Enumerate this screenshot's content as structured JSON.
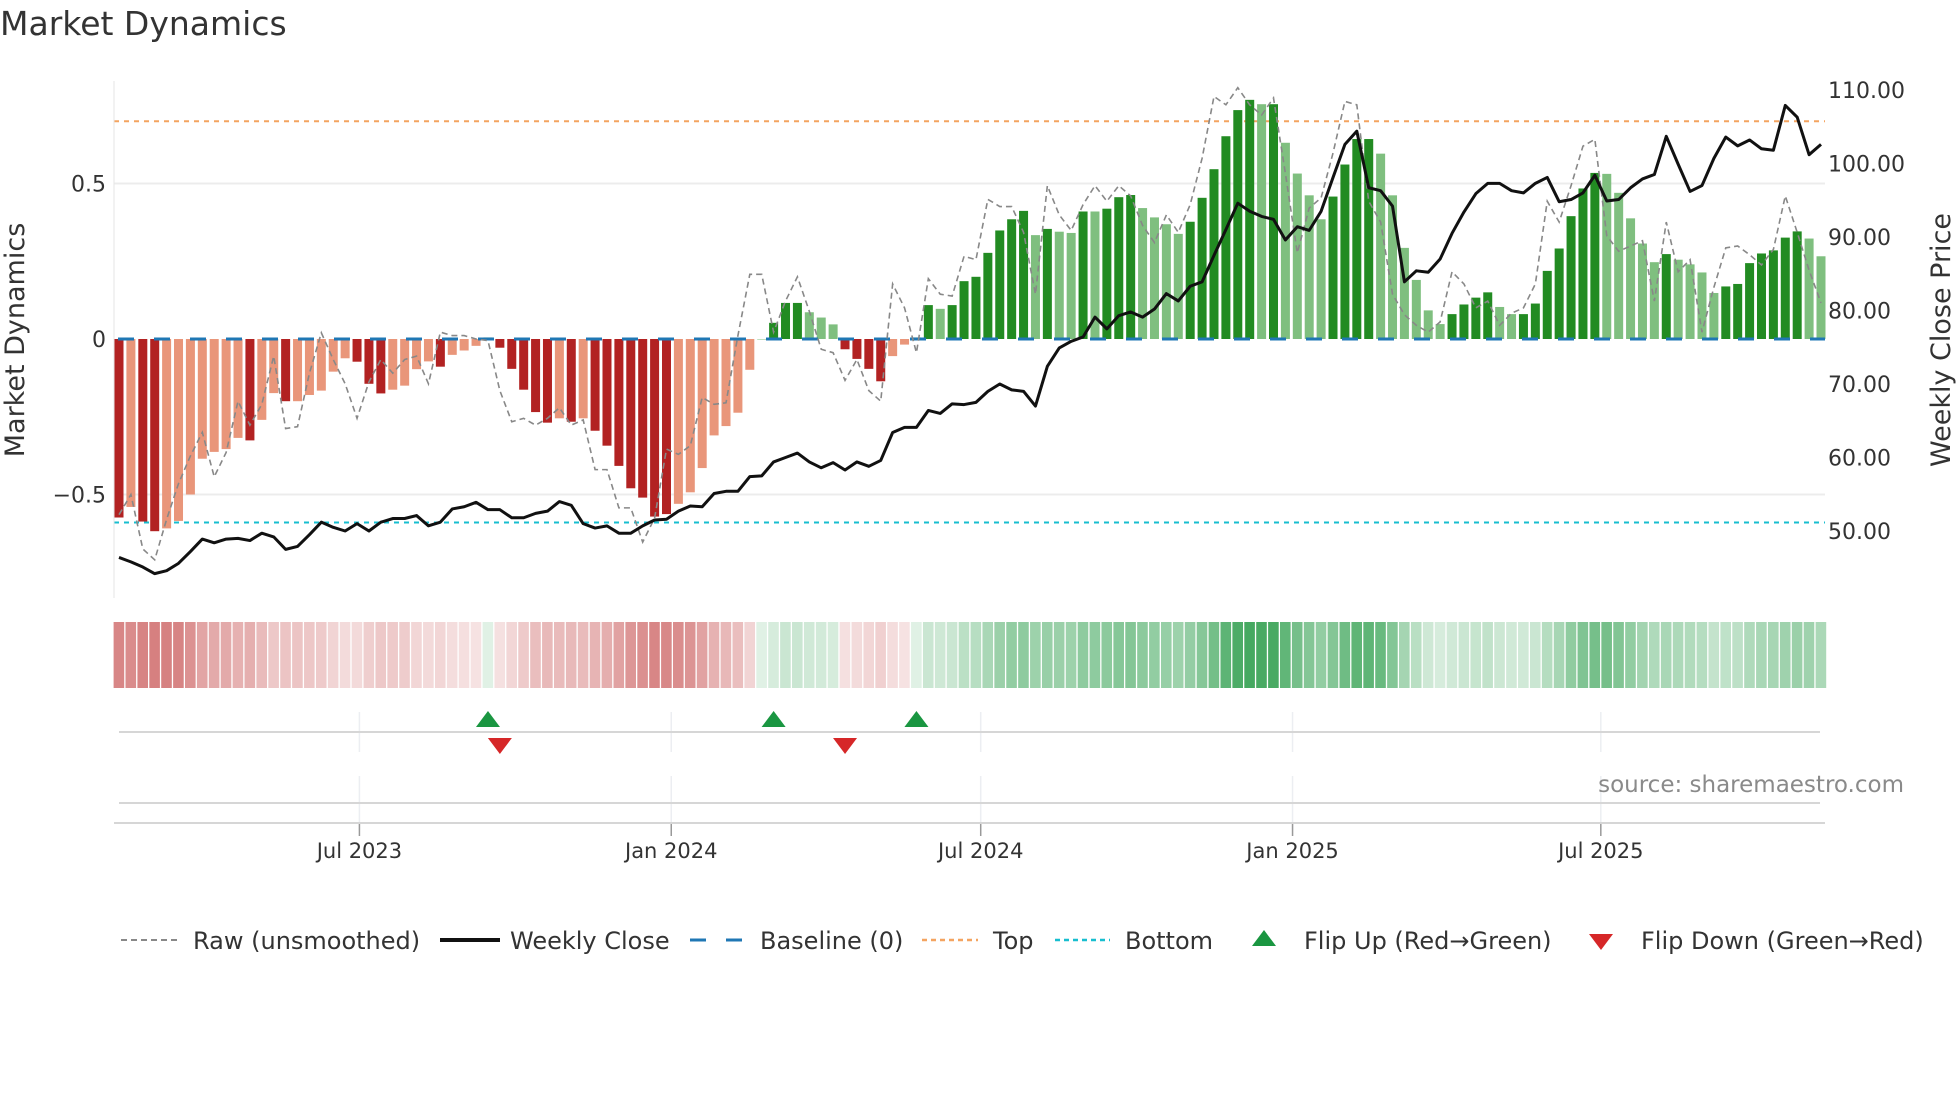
{
  "title": "Market Dynamics",
  "source": "source: sharemaestro.com",
  "colors": {
    "bar_red_dark": "#b22222",
    "bar_red_light": "#e9967a",
    "bar_green_dark": "#228b22",
    "bar_green_light": "#7fbf7f",
    "close": "#111111",
    "raw": "#888888",
    "baseline": "#1f77b4",
    "top": "#f4a460",
    "bottom": "#17becf",
    "flip_up": "#1a9641",
    "flip_down": "#d62728"
  },
  "chart_data": {
    "type": "bar",
    "title": "Market Dynamics",
    "ylabel": "Market Dynamics",
    "y2label": "Weekly Close Price",
    "ylim": [
      -0.78,
      0.85
    ],
    "y2lim": [
      40,
      113
    ],
    "yticks": [
      {
        "v": 0.5,
        "label": "0.5"
      },
      {
        "v": 0,
        "label": "0"
      },
      {
        "v": -0.5,
        "label": "−0.5"
      }
    ],
    "y2ticks": [
      {
        "v": 110,
        "label": "110.00"
      },
      {
        "v": 100,
        "label": "100.00"
      },
      {
        "v": 90,
        "label": "90.00"
      },
      {
        "v": 80,
        "label": "80.00"
      },
      {
        "v": 70,
        "label": "70.00"
      },
      {
        "v": 60,
        "label": "60.00"
      },
      {
        "v": 50,
        "label": "50.00"
      }
    ],
    "xticks": [
      {
        "week": 20.2,
        "label": "Jul 2023"
      },
      {
        "week": 46.4,
        "label": "Jan 2024"
      },
      {
        "week": 72.4,
        "label": "Jul 2024"
      },
      {
        "week": 98.6,
        "label": "Jan 2025"
      },
      {
        "week": 124.5,
        "label": "Jul 2025"
      }
    ],
    "top": 0.7,
    "bottom": -0.59,
    "baseline": 0,
    "values": [
      -0.574,
      -0.54,
      -0.587,
      -0.618,
      -0.609,
      -0.585,
      -0.5,
      -0.385,
      -0.363,
      -0.354,
      -0.318,
      -0.326,
      -0.26,
      -0.174,
      -0.2,
      -0.2,
      -0.18,
      -0.166,
      -0.105,
      -0.062,
      -0.073,
      -0.144,
      -0.175,
      -0.163,
      -0.15,
      -0.097,
      -0.072,
      -0.089,
      -0.051,
      -0.037,
      -0.022,
      0.005,
      -0.028,
      -0.096,
      -0.163,
      -0.235,
      -0.269,
      -0.255,
      -0.266,
      -0.255,
      -0.295,
      -0.343,
      -0.408,
      -0.48,
      -0.51,
      -0.571,
      -0.563,
      -0.53,
      -0.493,
      -0.415,
      -0.31,
      -0.28,
      -0.237,
      -0.099,
      0.0,
      0.052,
      0.116,
      0.116,
      0.086,
      0.069,
      0.047,
      -0.033,
      -0.064,
      -0.096,
      -0.136,
      -0.055,
      -0.018,
      0.005,
      0.109,
      0.097,
      0.109,
      0.186,
      0.2,
      0.277,
      0.349,
      0.385,
      0.412,
      0.334,
      0.354,
      0.345,
      0.341,
      0.41,
      0.41,
      0.419,
      0.456,
      0.463,
      0.421,
      0.391,
      0.369,
      0.338,
      0.377,
      0.454,
      0.546,
      0.652,
      0.736,
      0.769,
      0.755,
      0.755,
      0.631,
      0.532,
      0.462,
      0.385,
      0.458,
      0.561,
      0.643,
      0.643,
      0.596,
      0.462,
      0.293,
      0.19,
      0.092,
      0.048,
      0.08,
      0.111,
      0.133,
      0.15,
      0.103,
      0.08,
      0.08,
      0.114,
      0.219,
      0.291,
      0.395,
      0.484,
      0.534,
      0.531,
      0.47,
      0.388,
      0.307,
      0.247,
      0.273,
      0.255,
      0.24,
      0.214,
      0.148,
      0.169,
      0.177,
      0.244,
      0.275,
      0.285,
      0.326,
      0.346,
      0.323,
      0.266
    ],
    "shade": "DLDDLLLLLLLDLLDLLLLLDDDLLLLDLLLDDDDDDLDLDDDDDDDLLLLLLLLDDDLLLDDDDLLDDLDDDDDDDLDLLDLDDDLLLLDDDDDDLDLLLLDDDDLLLLLLDDDDLLDDDDDDDLLLLLDLLLLDDDDDDDLL",
    "raw": [
      -0.565,
      -0.5,
      -0.675,
      -0.71,
      -0.58,
      -0.465,
      -0.376,
      -0.3,
      -0.443,
      -0.365,
      -0.2,
      -0.277,
      -0.21,
      -0.055,
      -0.288,
      -0.282,
      -0.11,
      0.02,
      -0.066,
      -0.144,
      -0.255,
      -0.138,
      -0.066,
      -0.11,
      -0.066,
      -0.055,
      -0.144,
      0.022,
      0.011,
      0.011,
      0.0,
      -0.005,
      -0.166,
      -0.266,
      -0.255,
      -0.277,
      -0.255,
      -0.221,
      -0.277,
      -0.26,
      -0.42,
      -0.42,
      -0.543,
      -0.543,
      -0.653,
      -0.576,
      -0.354,
      -0.371,
      -0.343,
      -0.188,
      -0.21,
      -0.205,
      0.011,
      0.208,
      0.208,
      0.022,
      0.122,
      0.2,
      0.089,
      -0.033,
      -0.044,
      -0.133,
      -0.066,
      -0.166,
      -0.2,
      0.177,
      0.1,
      -0.044,
      0.194,
      0.144,
      0.138,
      0.266,
      0.255,
      0.449,
      0.426,
      0.426,
      0.343,
      0.144,
      0.493,
      0.399,
      0.349,
      0.432,
      0.493,
      0.443,
      0.493,
      0.46,
      0.365,
      0.31,
      0.399,
      0.343,
      0.432,
      0.581,
      0.78,
      0.753,
      0.808,
      0.753,
      0.72,
      0.775,
      0.532,
      0.277,
      0.421,
      0.454,
      0.598,
      0.764,
      0.753,
      0.443,
      0.376,
      0.144,
      0.078,
      0.044,
      0.022,
      0.055,
      0.216,
      0.177,
      0.1,
      0.122,
      0.044,
      0.083,
      0.1,
      0.177,
      0.443,
      0.376,
      0.493,
      0.62,
      0.642,
      0.332,
      0.282,
      0.299,
      0.316,
      0.122,
      0.376,
      0.216,
      0.255,
      0.022,
      0.166,
      0.293,
      0.299,
      0.271,
      0.238,
      0.288,
      0.46,
      0.343,
      0.221,
      0.116
    ],
    "close": [
      46.4,
      45.8,
      45.1,
      44.2,
      44.6,
      45.6,
      47.2,
      48.9,
      48.4,
      48.9,
      49.0,
      48.7,
      49.7,
      49.2,
      47.5,
      47.9,
      49.5,
      51.2,
      50.5,
      50.0,
      51.0,
      50.0,
      51.2,
      51.7,
      51.7,
      52.1,
      50.7,
      51.2,
      53.0,
      53.3,
      53.9,
      52.9,
      52.9,
      51.8,
      51.8,
      52.4,
      52.7,
      54.0,
      53.5,
      51.0,
      50.4,
      50.7,
      49.7,
      49.7,
      50.7,
      51.5,
      51.6,
      52.7,
      53.4,
      53.3,
      55.1,
      55.4,
      55.4,
      57.4,
      57.5,
      59.4,
      60.0,
      60.6,
      59.4,
      58.6,
      59.3,
      58.3,
      59.4,
      58.8,
      59.6,
      63.4,
      64.1,
      64.1,
      66.4,
      66.0,
      67.3,
      67.2,
      67.5,
      69.0,
      70.0,
      69.2,
      69.0,
      67.0,
      72.4,
      74.9,
      75.8,
      76.4,
      79.1,
      77.5,
      79.3,
      79.8,
      79.1,
      80.2,
      82.3,
      81.3,
      83.3,
      83.9,
      87.5,
      91.0,
      94.6,
      93.5,
      92.8,
      92.4,
      89.6,
      91.4,
      90.9,
      93.5,
      98.1,
      102.6,
      104.4,
      96.7,
      96.3,
      94.2,
      83.9,
      85.4,
      85.2,
      87.0,
      90.5,
      93.4,
      95.9,
      97.3,
      97.3,
      96.3,
      96.0,
      97.3,
      98.1,
      94.8,
      95.1,
      96.0,
      98.4,
      94.9,
      95.1,
      96.7,
      97.9,
      98.5,
      103.7,
      99.9,
      96.2,
      97.0,
      100.7,
      103.6,
      102.4,
      103.2,
      102.0,
      101.8,
      107.9,
      106.3,
      101.2,
      102.6
    ],
    "flips_up": [
      31,
      55,
      67
    ],
    "flips_down": [
      32,
      61
    ],
    "legend": {
      "placement": "bottom",
      "raw": "Raw (unsmoothed)",
      "close": "Weekly Close",
      "baseline": "Baseline (0)",
      "top": "Top",
      "bottom": "Bottom",
      "flip_up": "Flip Up (Red→Green)",
      "flip_down": "Flip Down (Green→Red)"
    }
  }
}
